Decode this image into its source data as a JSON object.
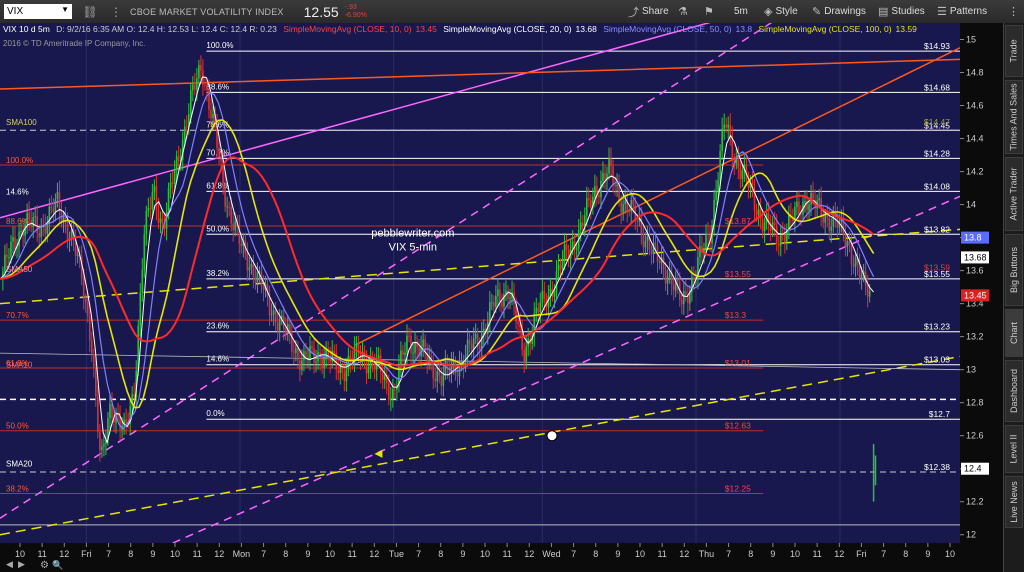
{
  "toolbar": {
    "symbol": "VIX",
    "title": "CBOE MARKET VOLATILITY INDEX",
    "price": "12.55",
    "change": "-.93",
    "change_pct": "-6.90%",
    "share_label": "Share",
    "timeframe_label": "5m",
    "style_label": "Style",
    "drawings_label": "Drawings",
    "studies_label": "Studies",
    "patterns_label": "Patterns"
  },
  "legend": {
    "title": "VIX 10 d 5m",
    "ohlc": "D: 9/2/16 6:35 AM  O: 12.4  H: 12.53  L: 12.4  C: 12.4  R: 0.23",
    "sma10": "SimpleMovingAvg (CLOSE, 10, 0)",
    "sma10_val": "13.45",
    "sma20": "SimpleMovingAvg (CLOSE, 20, 0)",
    "sma20_val": "13.68",
    "sma50": "SimpleMovingAvg (CLOSE, 50, 0)",
    "sma50_val": "13.8",
    "sma100": "SimpleMovingAvg (CLOSE, 100, 0)",
    "sma100_val": "13.59",
    "copyright": "2016 © TD Ameritrade IP Company, Inc."
  },
  "sidebar": {
    "tabs": [
      "Trade",
      "Times And Sales",
      "Active Trader",
      "Big Buttons",
      "Chart",
      "Dashboard",
      "Level II",
      "Live News"
    ]
  },
  "colors": {
    "background": "#18184f",
    "candle_up": "#2fbf3f",
    "candle_down": "#e03030",
    "sma10": "#ff2a2a",
    "sma20": "#ffffff",
    "sma50": "#8080ff",
    "sma100": "#e6e600",
    "magenta": "#ff66ff",
    "orange": "#ff5a1e"
  },
  "chart_data": {
    "type": "candlestick",
    "ylim": [
      11.95,
      15.1
    ],
    "yticks": [
      12,
      12.2,
      12.4,
      12.6,
      12.8,
      13,
      13.2,
      13.4,
      13.6,
      13.8,
      14,
      14.2,
      14.4,
      14.6,
      14.8,
      15
    ],
    "xticks": [
      "10",
      "11",
      "12",
      "Fri",
      "7",
      "8",
      "9",
      "10",
      "11",
      "12",
      "Mon",
      "7",
      "8",
      "9",
      "10",
      "11",
      "12",
      "Tue",
      "7",
      "8",
      "9",
      "10",
      "11",
      "12",
      "Wed",
      "7",
      "8",
      "9",
      "10",
      "11",
      "12",
      "Thu",
      "7",
      "8",
      "9",
      "10",
      "11",
      "12",
      "Fri",
      "7",
      "8",
      "9",
      "10"
    ],
    "annotation_title": "pebblewriter.com",
    "annotation_subtitle": "VIX 5-min",
    "price_labels": [
      {
        "text": "$14.93",
        "value": 14.93,
        "color": "#ffffff"
      },
      {
        "text": "$14.68",
        "value": 14.68,
        "color": "#ffffff"
      },
      {
        "text": "$14.45",
        "value": 14.45,
        "color": "#ffffff"
      },
      {
        "text": "$14.47",
        "value": 14.47,
        "color": "#a0a040"
      },
      {
        "text": "$14.28",
        "value": 14.28,
        "color": "#ffffff"
      },
      {
        "text": "$14.08",
        "value": 14.08,
        "color": "#ffffff"
      },
      {
        "text": "$13.82",
        "value": 13.82,
        "color": "#ffffff"
      },
      {
        "text": "$13.59",
        "value": 13.59,
        "color": "#e04040"
      },
      {
        "text": "$13.55",
        "value": 13.55,
        "color": "#ffffff"
      },
      {
        "text": "$13.23",
        "value": 13.23,
        "color": "#ffffff"
      },
      {
        "text": "$13.03",
        "value": 13.03,
        "color": "#ffffff"
      },
      {
        "text": "$12.7",
        "value": 12.7,
        "color": "#ffffff"
      },
      {
        "text": "$12.38",
        "value": 12.38,
        "color": "#ffffff"
      }
    ],
    "fib_white": [
      {
        "label": "100.0%",
        "value": 14.93
      },
      {
        "label": "88.6%",
        "value": 14.68
      },
      {
        "label": "78.6%",
        "value": 14.45
      },
      {
        "label": "70.7%",
        "value": 14.28
      },
      {
        "label": "61.8%",
        "value": 14.08
      },
      {
        "label": "50.0%",
        "value": 13.82
      },
      {
        "label": "38.2%",
        "value": 13.55
      },
      {
        "label": "23.6%",
        "value": 13.23
      },
      {
        "label": "14.6%",
        "value": 13.03
      },
      {
        "label": "0.0%",
        "value": 12.7
      }
    ],
    "fib_red": [
      {
        "label": "100.0%",
        "value": 14.24
      },
      {
        "label": "88.6%",
        "value": 13.87
      },
      {
        "label": "70.7%",
        "value": 13.3
      },
      {
        "label": "61.8%",
        "value": 13.01
      },
      {
        "label": "50.0%",
        "value": 12.63
      },
      {
        "label": "38.2%",
        "value": 12.25
      }
    ],
    "red_inline_labels": [
      {
        "text": "$13.87",
        "value": 13.87
      },
      {
        "text": "$13.55",
        "value": 13.55
      },
      {
        "text": "$13.3",
        "value": 13.3
      },
      {
        "text": "$13.01",
        "value": 13.01
      },
      {
        "text": "$12.63",
        "value": 12.63
      },
      {
        "text": "$12.25",
        "value": 12.25
      }
    ],
    "left_labels": [
      {
        "text": "SMA100",
        "value": 14.47,
        "color": "#d0d060"
      },
      {
        "text": "14.6%",
        "value": 14.05,
        "color": "#ffffff"
      },
      {
        "text": "SMA50",
        "value": 13.58,
        "color": "#ff9090"
      },
      {
        "text": "SMA10",
        "value": 13.0,
        "color": "#ff6060"
      },
      {
        "text": "SMA20",
        "value": 12.4,
        "color": "#ffffff"
      }
    ],
    "axis_badges": [
      {
        "text": "13.8",
        "value": 13.8,
        "bg": "#5a6cff",
        "fg": "#ffffff"
      },
      {
        "text": "13.68",
        "value": 13.68,
        "bg": "#ffffff",
        "fg": "#000000"
      },
      {
        "text": "13.45",
        "value": 13.45,
        "bg": "#e02020",
        "fg": "#ffffff"
      },
      {
        "text": "12.4",
        "value": 12.4,
        "bg": "#ffffff",
        "fg": "#000000"
      }
    ],
    "close_path": [
      [
        0.0,
        13.55
      ],
      [
        0.01,
        13.7
      ],
      [
        0.025,
        13.9
      ],
      [
        0.04,
        13.85
      ],
      [
        0.06,
        14.0
      ],
      [
        0.075,
        13.8
      ],
      [
        0.085,
        13.55
      ],
      [
        0.095,
        13.2
      ],
      [
        0.105,
        12.4
      ],
      [
        0.115,
        12.8
      ],
      [
        0.13,
        12.6
      ],
      [
        0.14,
        12.9
      ],
      [
        0.15,
        13.8
      ],
      [
        0.16,
        14.1
      ],
      [
        0.17,
        13.85
      ],
      [
        0.18,
        14.15
      ],
      [
        0.19,
        14.4
      ],
      [
        0.2,
        14.65
      ],
      [
        0.21,
        14.85
      ],
      [
        0.22,
        14.55
      ],
      [
        0.235,
        14.05
      ],
      [
        0.25,
        13.75
      ],
      [
        0.265,
        13.6
      ],
      [
        0.28,
        13.4
      ],
      [
        0.3,
        13.2
      ],
      [
        0.315,
        13.05
      ],
      [
        0.335,
        13.1
      ],
      [
        0.355,
        13.0
      ],
      [
        0.375,
        13.1
      ],
      [
        0.395,
        13.0
      ],
      [
        0.41,
        12.85
      ],
      [
        0.425,
        13.2
      ],
      [
        0.44,
        13.1
      ],
      [
        0.46,
        12.95
      ],
      [
        0.48,
        13.05
      ],
      [
        0.5,
        13.2
      ],
      [
        0.515,
        13.4
      ],
      [
        0.53,
        13.5
      ],
      [
        0.545,
        13.1
      ],
      [
        0.56,
        13.35
      ],
      [
        0.575,
        13.5
      ],
      [
        0.59,
        13.7
      ],
      [
        0.605,
        13.85
      ],
      [
        0.62,
        14.1
      ],
      [
        0.635,
        14.2
      ],
      [
        0.65,
        14.0
      ],
      [
        0.665,
        13.9
      ],
      [
        0.68,
        13.7
      ],
      [
        0.695,
        13.6
      ],
      [
        0.71,
        13.4
      ],
      [
        0.725,
        13.6
      ],
      [
        0.74,
        13.85
      ],
      [
        0.755,
        14.5
      ],
      [
        0.765,
        14.3
      ],
      [
        0.78,
        14.1
      ],
      [
        0.795,
        13.9
      ],
      [
        0.81,
        13.8
      ],
      [
        0.825,
        13.9
      ],
      [
        0.84,
        14.05
      ],
      [
        0.855,
        13.95
      ],
      [
        0.87,
        13.9
      ],
      [
        0.885,
        13.75
      ],
      [
        0.9,
        13.5
      ],
      [
        0.91,
        13.45
      ]
    ],
    "last_bars": [
      [
        0.91,
        12.55,
        12.2
      ],
      [
        0.912,
        12.48,
        12.3
      ]
    ]
  }
}
